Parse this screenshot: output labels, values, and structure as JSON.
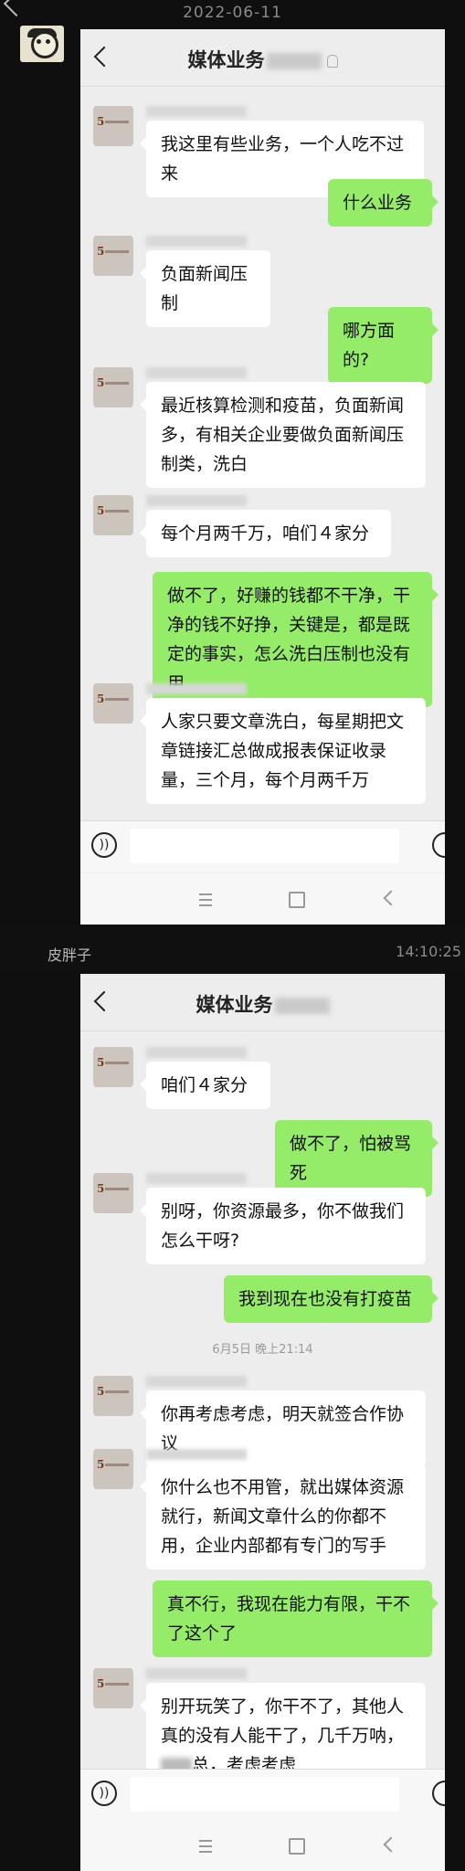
{
  "top": {
    "date": "2022-06-11"
  },
  "strip": {
    "name": "皮胖子",
    "time": "14:10:25"
  },
  "chat1": {
    "title": "媒体业务",
    "messages": [
      {
        "dir": "in",
        "text": "我这里有些业务，一个人吃不过来"
      },
      {
        "dir": "out",
        "text": "什么业务"
      },
      {
        "dir": "in",
        "text": "负面新闻压制"
      },
      {
        "dir": "out",
        "text": "哪方面的?"
      },
      {
        "dir": "in",
        "text": "最近核算检测和疫苗，负面新闻多，有相关企业要做负面新闻压制类，洗白"
      },
      {
        "dir": "in",
        "text": "每个月两千万，咱们４家分"
      },
      {
        "dir": "out",
        "text": "做不了，好赚的钱都不干净，干净的钱不好挣，关键是，都是既定的事实，怎么洗白压制也没有用"
      },
      {
        "dir": "in",
        "text": "人家只要文章洗白，每星期把文章链接汇总做成报表保证收录量，三个月，每个月两千万"
      }
    ]
  },
  "chat2": {
    "title": "媒体业务",
    "messages": [
      {
        "dir": "in",
        "text": "咱们４家分"
      },
      {
        "dir": "out",
        "text": "做不了，怕被骂死"
      },
      {
        "dir": "in",
        "text": "别呀，你资源最多，你不做我们怎么干呀?"
      },
      {
        "dir": "out",
        "text": "我到现在也没有打疫苗"
      },
      {
        "dir": "in",
        "text": "你再考虑考虑，明天就签合作协议"
      },
      {
        "dir": "in",
        "text": "你什么也不用管，就出媒体资源就行，新闻文章什么的你都不用，企业内部都有专门的写手"
      },
      {
        "dir": "out",
        "text": "真不行，我现在能力有限，干不了这个了"
      },
      {
        "dir": "in",
        "text_a": "别开玩笑了，你干不了，其他人真的没有人能干了，几千万呐，",
        "text_b": "总，考虑考虑"
      }
    ],
    "timestamp": "6月5日 晚上21:14"
  },
  "icons": [
    "back-icon",
    "mute-icon",
    "voice-icon",
    "emoji-icon",
    "menu-icon",
    "home-icon",
    "nav-back-icon"
  ],
  "colors": {
    "outgoing_bubble": "#95ec69",
    "incoming_bubble": "#ffffff",
    "chat_bg": "#ededed"
  }
}
